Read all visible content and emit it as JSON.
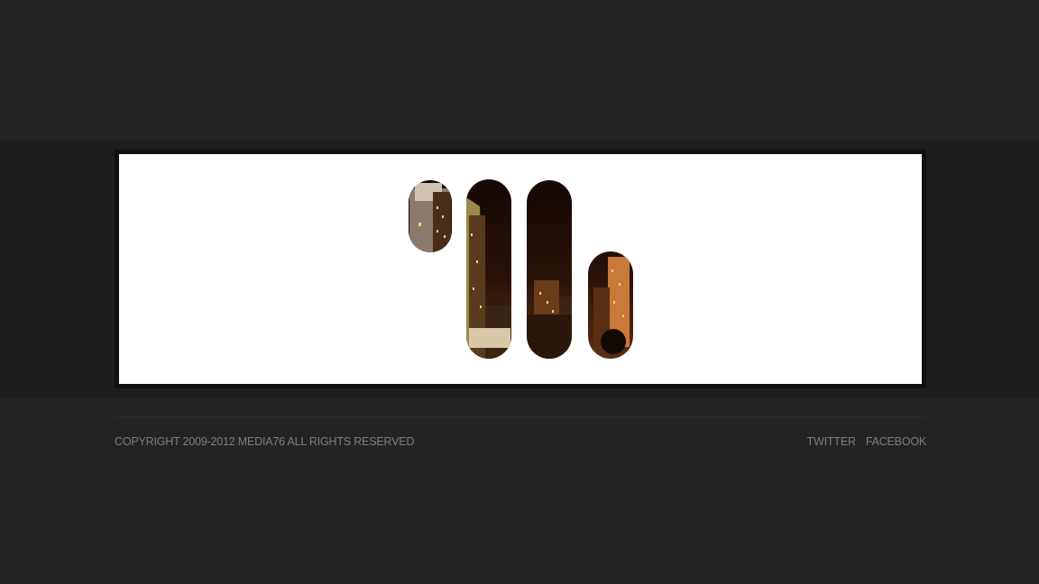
{
  "logo": {
    "icon": "media76-skyline-logo",
    "colors": {
      "sky": "#1a0b06",
      "glow": "#6b3a14",
      "building": "#3a2212",
      "lights": "#ffcf6a"
    }
  },
  "footer": {
    "copyright": "COPYRIGHT 2009-2012 MEDIA76 ALL RIGHTS RESERVED",
    "links": [
      "TWITTER",
      "FACEBOOK"
    ]
  }
}
